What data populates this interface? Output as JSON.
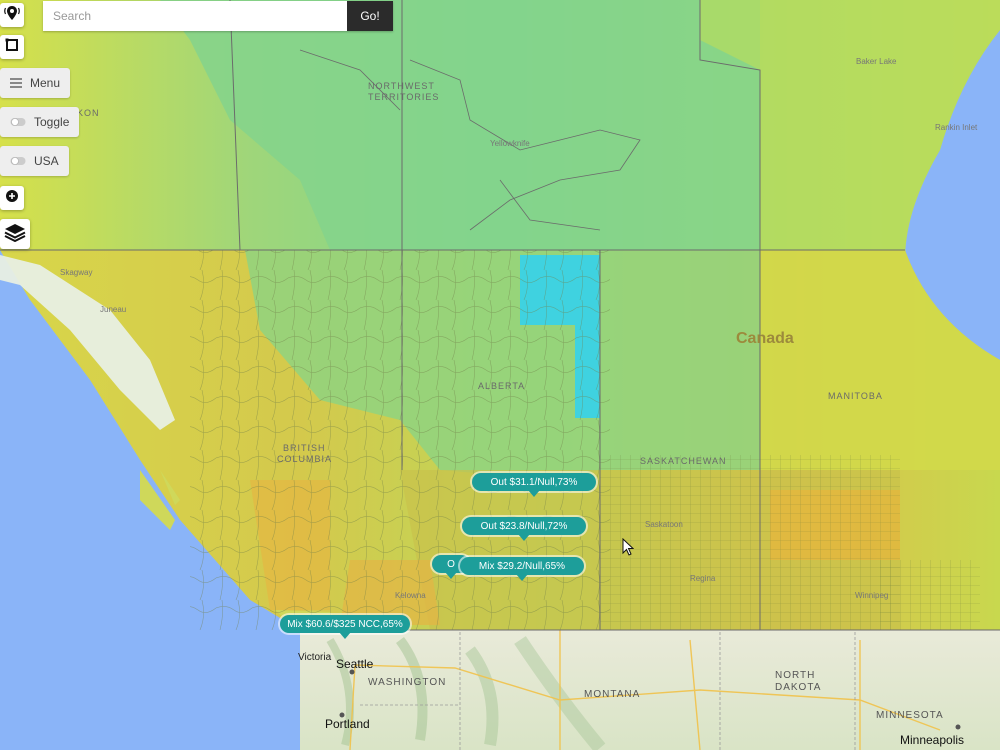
{
  "search": {
    "placeholder": "Search",
    "go_label": "Go!"
  },
  "controls": {
    "menu_label": "Menu",
    "toggle_label": "Toggle",
    "usa_label": "USA"
  },
  "map_labels": {
    "canada": "Canada",
    "northwest_territories_1": "NORTHWEST",
    "northwest_territories_2": "TERRITORIES",
    "yukon": "KON",
    "yellowknife": "Yellowknife",
    "baker_lake": "Baker Lake",
    "rankin_inlet": "Rankin Inlet",
    "juneau": "Juneau",
    "skagway": "Skagway",
    "alberta": "ALBERTA",
    "british_columbia_1": "BRITISH",
    "british_columbia_2": "COLUMBIA",
    "saskatchewan": "SASKATCHEWAN",
    "manitoba": "MANITOBA",
    "saskatoon": "Saskatoon",
    "regina": "Regina",
    "winnipeg": "Winnipeg",
    "kelowna": "Kelowna",
    "victoria": "Victoria",
    "seattle": "Seattle",
    "washington": "WASHINGTON",
    "portland": "Portland",
    "montana": "MONTANA",
    "north_dakota_1": "NORTH",
    "north_dakota_2": "DAKOTA",
    "minnesota": "MINNESOTA",
    "minneapolis": "Minneapolis"
  },
  "popups": [
    {
      "text": "Out $31.1/Null,73%"
    },
    {
      "text": "Out $23.8/Null,72%"
    },
    {
      "text": "Mix $29.2/Null,65%"
    },
    {
      "text": "O"
    },
    {
      "text": "Mix $60.6/$325 NCC,65%"
    }
  ],
  "icons": {
    "location": "location-pin-icon",
    "draw": "square-draw-icon",
    "menu": "hamburger-icon",
    "toggle": "toggle-icon",
    "zoom": "plus-circle-icon",
    "layers": "layers-icon"
  }
}
